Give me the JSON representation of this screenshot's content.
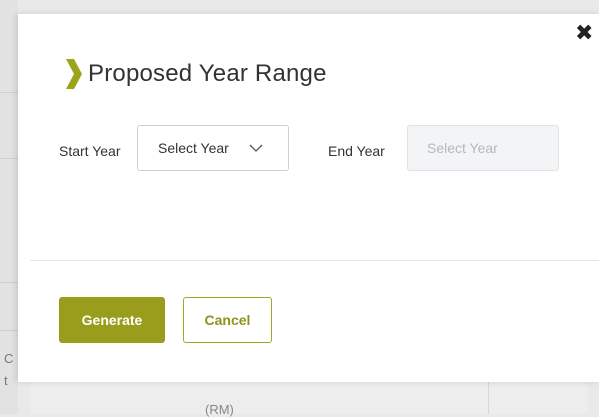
{
  "background": {
    "fragment_texts": [
      "C",
      "t"
    ],
    "table_header": "(RM)"
  },
  "modal": {
    "title": "Proposed Year Range",
    "close_icon": "close-icon",
    "start_year": {
      "label": "Start Year",
      "value": "Select Year"
    },
    "end_year": {
      "label": "End Year",
      "placeholder": "Select Year",
      "disabled": true
    },
    "buttons": {
      "generate": "Generate",
      "cancel": "Cancel"
    }
  },
  "colors": {
    "accent": "#9a9d1b",
    "chevron": "#9ca41a",
    "disabled_bg": "#f3f4f6"
  }
}
